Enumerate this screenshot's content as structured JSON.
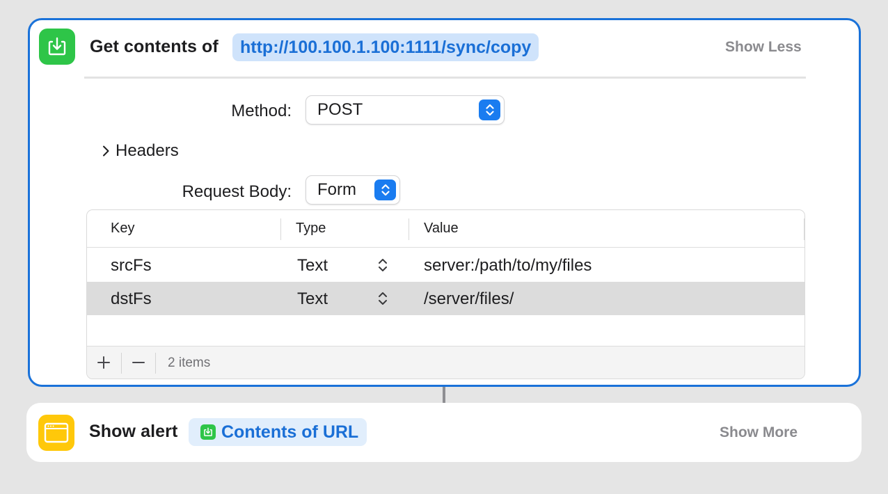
{
  "get_contents": {
    "title": "Get contents of",
    "url": "http://100.100.1.100:1111/sync/copy",
    "toggle_label": "Show Less",
    "method_label": "Method:",
    "method_value": "POST",
    "headers_label": "Headers",
    "request_body_label": "Request Body:",
    "request_body_value": "Form",
    "table": {
      "columns": [
        "Key",
        "Type",
        "Value"
      ],
      "rows": [
        {
          "key": "srcFs",
          "type": "Text",
          "value": "server:/path/to/my/files"
        },
        {
          "key": "dstFs",
          "type": "Text",
          "value": "/server/files/"
        }
      ],
      "item_count": "2 items"
    },
    "icon": "download-tray-icon"
  },
  "show_alert": {
    "title": "Show alert",
    "variable": "Contents of URL",
    "toggle_label": "Show More",
    "icon": "alert-window-icon"
  },
  "colors": {
    "accent": "#1a72d9",
    "green_icon": "#2ec548",
    "yellow_icon": "#ffc80a",
    "token_bg": "#cfe3fb",
    "selected_row": "#dcdcdc"
  }
}
